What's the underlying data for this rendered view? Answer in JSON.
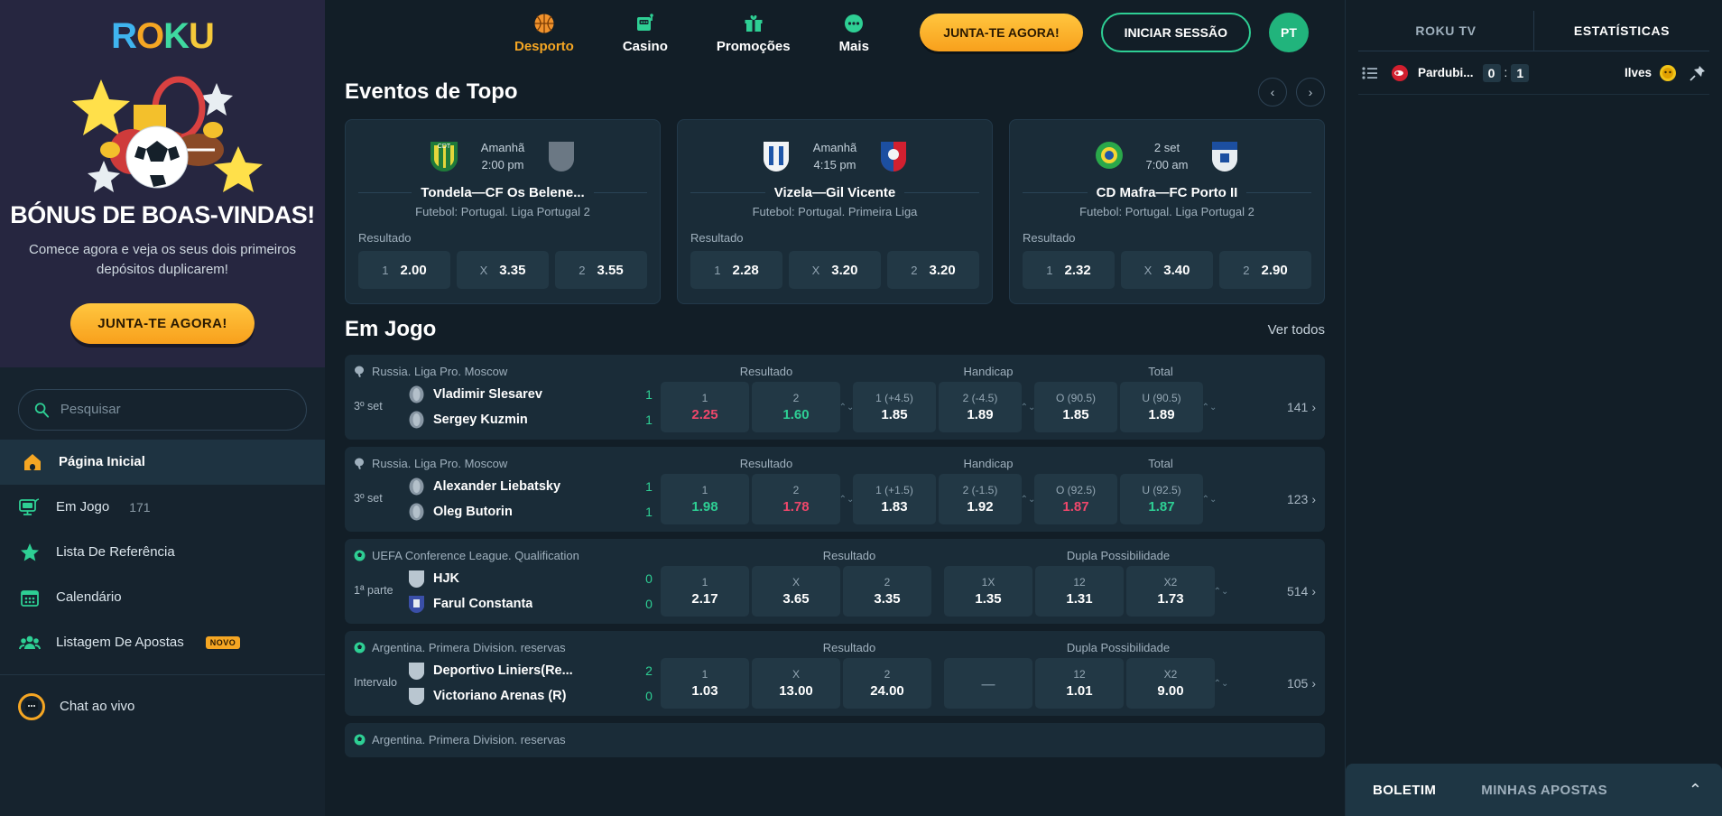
{
  "brand": {
    "name": "ROKU",
    "letters": [
      "R",
      "O",
      "K",
      "U"
    ]
  },
  "promo": {
    "title": "BÓNUS DE BOAS-VINDAS!",
    "subtitle": "Comece agora e veja os seus dois primeiros depósitos duplicarem!",
    "cta": "JUNTA-TE AGORA!"
  },
  "search": {
    "placeholder": "Pesquisar",
    "value": ""
  },
  "sidebar": {
    "items": [
      {
        "label": "Página Inicial",
        "icon": "home-icon",
        "count": "",
        "badge": "",
        "active": true
      },
      {
        "label": "Em Jogo",
        "icon": "live-tv-icon",
        "count": "171",
        "badge": "",
        "active": false
      },
      {
        "label": "Lista De Referência",
        "icon": "star-icon",
        "count": "",
        "badge": "",
        "active": false
      },
      {
        "label": "Calendário",
        "icon": "calendar-icon",
        "count": "",
        "badge": "",
        "active": false
      },
      {
        "label": "Listagem De Apostas",
        "icon": "users-icon",
        "count": "",
        "badge": "NOVO",
        "active": false
      }
    ],
    "chat": {
      "label": "Chat ao vivo",
      "icon": "chat-icon"
    }
  },
  "topnav": {
    "items": [
      {
        "label": "Desporto",
        "icon": "basketball-icon",
        "active": true
      },
      {
        "label": "Casino",
        "icon": "slot-machine-icon",
        "active": false
      },
      {
        "label": "Promoções",
        "icon": "gift-icon",
        "active": false
      },
      {
        "label": "Mais",
        "icon": "dots-icon",
        "active": false
      }
    ],
    "join": "JUNTA-TE AGORA!",
    "login": "INICIAR SESSÃO",
    "lang": "PT"
  },
  "top_events": {
    "title": "Eventos de Topo",
    "prev": "‹",
    "next": "›",
    "cards": [
      {
        "date": "Amanhã",
        "time": "2:00 pm",
        "match": "Tondela—CF Os Belene...",
        "league": "Futebol: Portugal. Liga Portugal 2",
        "market": "Resultado",
        "home_crest": "cd-tondela-crest",
        "away_crest": "belenenses-crest",
        "odds": [
          {
            "key": "1",
            "value": "2.00"
          },
          {
            "key": "X",
            "value": "3.35"
          },
          {
            "key": "2",
            "value": "3.55"
          }
        ]
      },
      {
        "date": "Amanhã",
        "time": "4:15 pm",
        "match": "Vizela—Gil Vicente",
        "league": "Futebol: Portugal. Primeira Liga",
        "market": "Resultado",
        "home_crest": "vizela-crest",
        "away_crest": "gil-vicente-crest",
        "odds": [
          {
            "key": "1",
            "value": "2.28"
          },
          {
            "key": "X",
            "value": "3.20"
          },
          {
            "key": "2",
            "value": "3.20"
          }
        ]
      },
      {
        "date": "2 set",
        "time": "7:00 am",
        "match": "CD Mafra—FC Porto II",
        "league": "Futebol: Portugal. Liga Portugal 2",
        "market": "Resultado",
        "home_crest": "cd-mafra-crest",
        "away_crest": "fc-porto-crest",
        "odds": [
          {
            "key": "1",
            "value": "2.32"
          },
          {
            "key": "X",
            "value": "3.40"
          },
          {
            "key": "2",
            "value": "2.90"
          }
        ]
      }
    ]
  },
  "live": {
    "title": "Em Jogo",
    "see_all": "Ver todos",
    "rows": [
      {
        "league": "Russia. Liga Pro. Moscow",
        "sport_icon": "table-tennis-icon",
        "period": "3º set",
        "home": "Vladimir Slesarev",
        "away": "Sergey Kuzmin",
        "home_score": "1",
        "away_score": "1",
        "more": "141",
        "markets": [
          {
            "name": "Resultado",
            "width": "w3",
            "stepper": false,
            "cells": [
              {
                "key": "1",
                "value": "2.25",
                "trend": "down"
              },
              {
                "key": "2",
                "value": "1.60",
                "trend": "up"
              }
            ]
          },
          {
            "name": "Handicap",
            "width": "w2",
            "stepper": true,
            "cells": [
              {
                "key": "1 (+4.5)",
                "value": "1.85",
                "trend": ""
              },
              {
                "key": "2 (-4.5)",
                "value": "1.89",
                "trend": ""
              }
            ]
          },
          {
            "name": "Total",
            "width": "w2b",
            "stepper": true,
            "cells": [
              {
                "key": "O (90.5)",
                "value": "1.85",
                "trend": ""
              },
              {
                "key": "U (90.5)",
                "value": "1.89",
                "trend": ""
              }
            ]
          }
        ]
      },
      {
        "league": "Russia. Liga Pro. Moscow",
        "sport_icon": "table-tennis-icon",
        "period": "3º set",
        "home": "Alexander Liebatsky",
        "away": "Oleg Butorin",
        "home_score": "1",
        "away_score": "1",
        "more": "123",
        "markets": [
          {
            "name": "Resultado",
            "width": "w3",
            "stepper": false,
            "cells": [
              {
                "key": "1",
                "value": "1.98",
                "trend": "up"
              },
              {
                "key": "2",
                "value": "1.78",
                "trend": "down"
              }
            ]
          },
          {
            "name": "Handicap",
            "width": "w2",
            "stepper": true,
            "cells": [
              {
                "key": "1 (+1.5)",
                "value": "1.83",
                "trend": ""
              },
              {
                "key": "2 (-1.5)",
                "value": "1.92",
                "trend": ""
              }
            ]
          },
          {
            "name": "Total",
            "width": "w2b",
            "stepper": true,
            "cells": [
              {
                "key": "O (92.5)",
                "value": "1.87",
                "trend": "down"
              },
              {
                "key": "U (92.5)",
                "value": "1.87",
                "trend": "up"
              }
            ]
          }
        ]
      },
      {
        "league": "UEFA Conference League. Qualification",
        "sport_icon": "football-icon",
        "period": "1ª parte",
        "home": "HJK",
        "away": "Farul Constanta",
        "home_score": "0",
        "away_score": "0",
        "more": "514",
        "markets": [
          {
            "name": "Resultado",
            "width": "w3",
            "stepper": false,
            "cells": [
              {
                "key": "1",
                "value": "2.17",
                "trend": ""
              },
              {
                "key": "X",
                "value": "3.65",
                "trend": ""
              },
              {
                "key": "2",
                "value": "3.35",
                "trend": ""
              }
            ]
          },
          {
            "name": "Dupla Possibilidade",
            "width": "w3b",
            "stepper": false,
            "cells": [
              {
                "key": "1X",
                "value": "1.35",
                "trend": ""
              },
              {
                "key": "12",
                "value": "1.31",
                "trend": ""
              },
              {
                "key": "X2",
                "value": "1.73",
                "trend": ""
              }
            ]
          }
        ]
      },
      {
        "league": "Argentina. Primera Division. reservas",
        "sport_icon": "football-icon",
        "period": "Intervalo",
        "home": "Deportivo Liniers(Re...",
        "away": "Victoriano Arenas (R)",
        "home_score": "2",
        "away_score": "0",
        "more": "105",
        "markets": [
          {
            "name": "Resultado",
            "width": "w3",
            "stepper": false,
            "cells": [
              {
                "key": "1",
                "value": "1.03",
                "trend": ""
              },
              {
                "key": "X",
                "value": "13.00",
                "trend": ""
              },
              {
                "key": "2",
                "value": "24.00",
                "trend": ""
              }
            ]
          },
          {
            "name": "Dupla Possibilidade",
            "width": "w3b",
            "stepper": false,
            "cells": [
              {
                "key": "",
                "value": "—",
                "trend": "dash"
              },
              {
                "key": "12",
                "value": "1.01",
                "trend": ""
              },
              {
                "key": "X2",
                "value": "9.00",
                "trend": ""
              }
            ]
          }
        ]
      },
      {
        "league": "Argentina. Primera Division. reservas",
        "sport_icon": "football-icon",
        "period": "",
        "home": "",
        "away": "",
        "home_score": "",
        "away_score": "",
        "more": "",
        "markets": []
      }
    ]
  },
  "right_panel": {
    "tabs": [
      {
        "label": "ROKU TV",
        "active": false
      },
      {
        "label": "ESTATÍSTICAS",
        "active": true
      }
    ],
    "match": {
      "list_icon": "list-icon",
      "home": "Pardubi...",
      "home_crest": "pardubice-crest",
      "home_score": "0",
      "separator": ":",
      "away_score": "1",
      "away": "Ilves",
      "away_crest": "ilves-crest",
      "pin_icon": "pin-icon"
    },
    "betslip": {
      "tabs": [
        {
          "label": "BOLETIM",
          "active": true
        },
        {
          "label": "MINHAS APOSTAS",
          "active": false
        }
      ],
      "caret": "⌃"
    }
  },
  "colors": {
    "accent_orange": "#f5a623",
    "accent_green": "#2ecf94",
    "down_red": "#f0476b",
    "bg": "#121e27",
    "panel": "#1a2c38"
  }
}
